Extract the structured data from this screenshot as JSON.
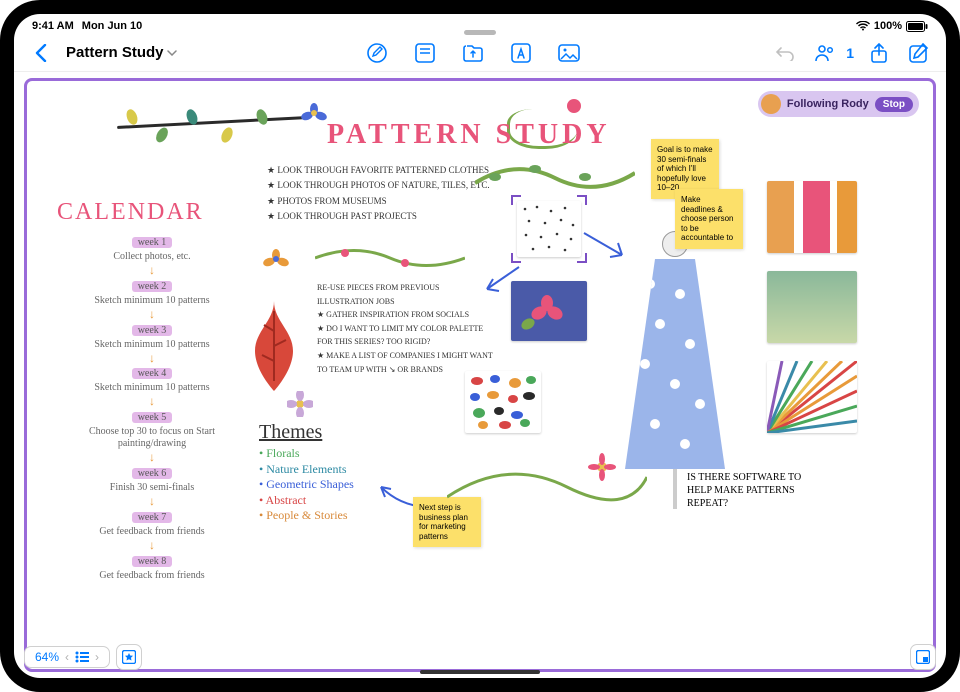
{
  "status": {
    "time": "9:41 AM",
    "date": "Mon Jun 10",
    "battery": "100%"
  },
  "toolbar": {
    "back_label": "",
    "title": "Pattern Study",
    "collab_count": "1"
  },
  "follow": {
    "text": "Following Rody",
    "stop": "Stop"
  },
  "board": {
    "title": "PATTERN STUDY"
  },
  "calendar": {
    "heading": "CALENDAR",
    "weeks": [
      {
        "label": "week 1",
        "desc": "Collect photos, etc."
      },
      {
        "label": "week 2",
        "desc": "Sketch minimum 10 patterns"
      },
      {
        "label": "week 3",
        "desc": "Sketch minimum 10 patterns"
      },
      {
        "label": "week 4",
        "desc": "Sketch minimum 10 patterns"
      },
      {
        "label": "week 5",
        "desc": "Choose top 30 to focus on\nStart painting/drawing"
      },
      {
        "label": "week 6",
        "desc": "Finish 30 semi-finals"
      },
      {
        "label": "week 7",
        "desc": "Get feedback from friends"
      },
      {
        "label": "week 8",
        "desc": "Get feedback from friends"
      }
    ]
  },
  "notes_top": [
    "★ LOOK THROUGH FAVORITE PATTERNED CLOTHES",
    "★ LOOK THROUGH PHOTOS OF NATURE, TILES, ETC.",
    "★ PHOTOS FROM MUSEUMS",
    "★ LOOK THROUGH PAST PROJECTS"
  ],
  "notes_mid": [
    "RE-USE PIECES FROM PREVIOUS ILLUSTRATION JOBS",
    "★ GATHER INSPIRATION FROM SOCIALS",
    "★ DO I WANT TO LIMIT MY COLOR PALETTE FOR THIS SERIES? TOO RIGID?",
    "★ MAKE A LIST OF COMPANIES I MIGHT WANT TO TEAM UP WITH   ↘ OR BRANDS"
  ],
  "themes": {
    "heading": "Themes",
    "items": [
      {
        "text": "• Florals",
        "cls": "c-green"
      },
      {
        "text": "• Nature Elements",
        "cls": "c-teal"
      },
      {
        "text": "• Geometric Shapes",
        "cls": "c-blue"
      },
      {
        "text": "• Abstract",
        "cls": "c-red"
      },
      {
        "text": "• People & Stories",
        "cls": "c-orange"
      }
    ]
  },
  "stickies": {
    "yellow1": "Goal is to make 30 semi-finals of which I'll hopefully love 10–20",
    "yellow2": "Make deadlines & choose person to be accountable to",
    "yellow3": "Next step is business plan for marketing patterns"
  },
  "question": "IS THERE SOFTWARE TO HELP MAKE PATTERNS REPEAT?",
  "zoom": {
    "value": "64%"
  }
}
